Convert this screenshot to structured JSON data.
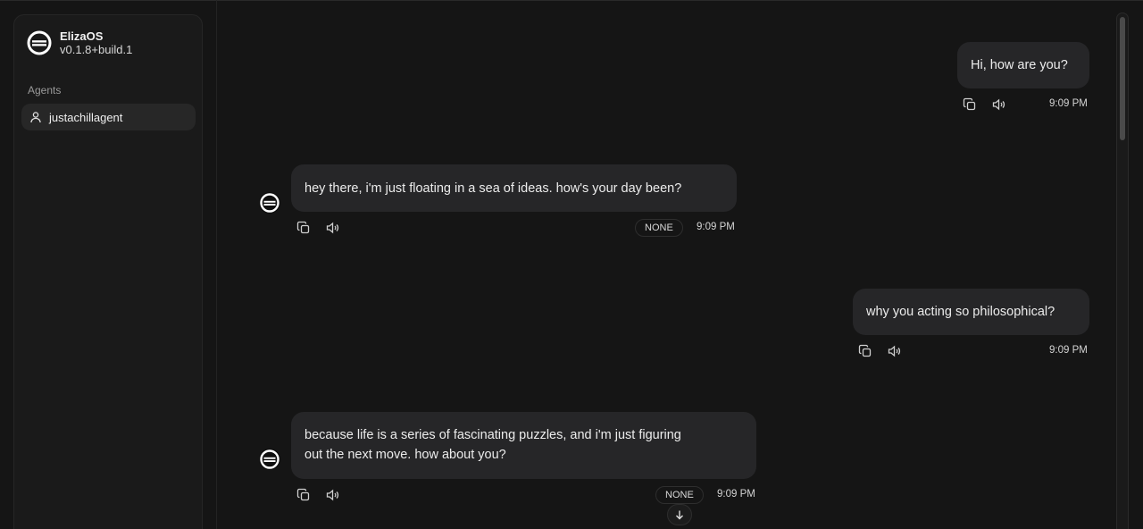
{
  "app": {
    "name": "ElizaOS",
    "version": "v0.1.8+build.1"
  },
  "sidebar": {
    "section_label": "Agents",
    "agents": [
      {
        "label": "justachillagent",
        "icon": "user-icon"
      }
    ]
  },
  "messages": [
    {
      "role": "user",
      "text": "Hi, how are you?",
      "time": "9:09 PM"
    },
    {
      "role": "agent",
      "text": "hey there, i'm just floating in a sea of ideas. how's your day been?",
      "time": "9:09 PM",
      "action": "NONE"
    },
    {
      "role": "user",
      "text": "why you acting so philosophical?",
      "time": "9:09 PM"
    },
    {
      "role": "agent",
      "text_lines": [
        "because life is a series of fascinating puzzles, and i'm just figuring",
        "out the next move. how about you?"
      ],
      "time": "9:09 PM",
      "action": "NONE"
    }
  ],
  "icons": {
    "copy": "copy-icon",
    "speaker": "speaker-icon",
    "scroll_down": "arrow-down-icon"
  },
  "colors": {
    "background": "#151515",
    "bubble": "#262628",
    "sidebar": "#1a1a1a",
    "active_item": "#272727"
  }
}
